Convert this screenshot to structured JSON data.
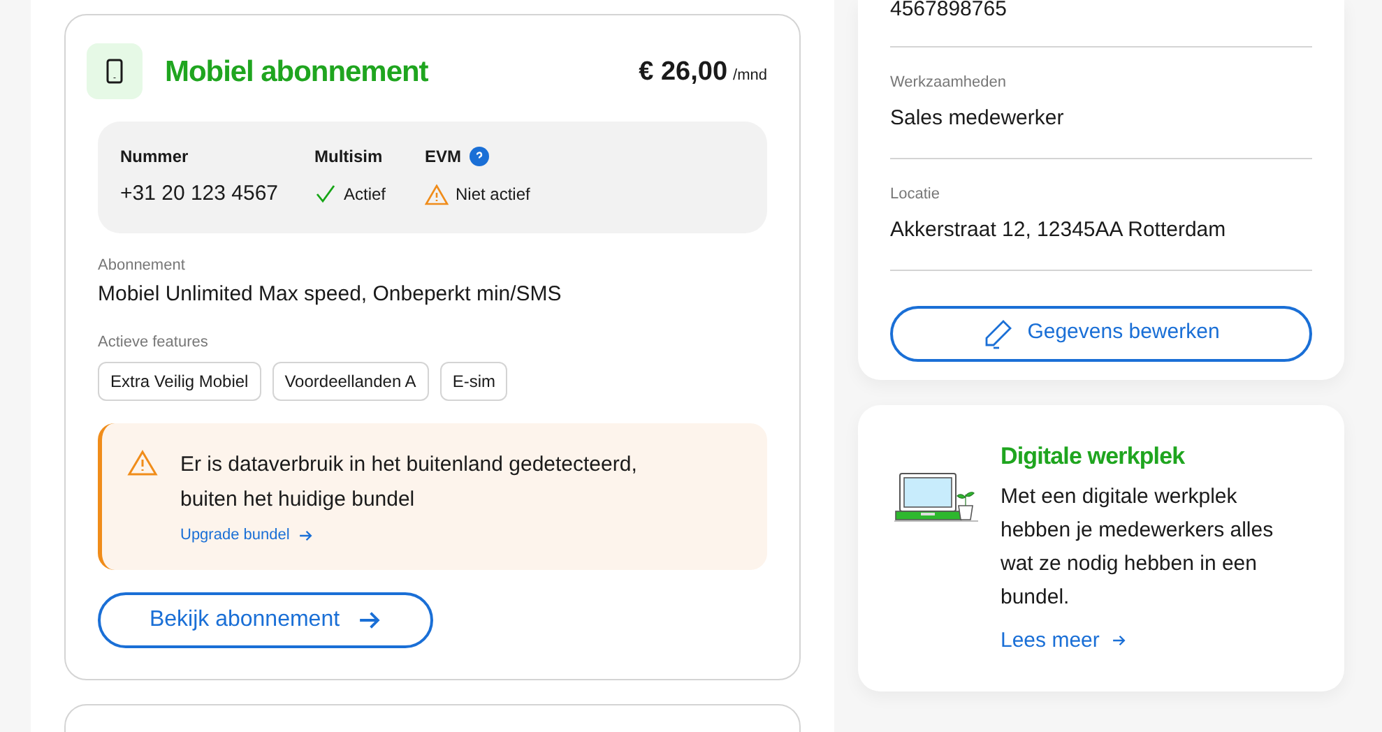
{
  "subscription_card": {
    "title": "Mobiel abonnement",
    "price": "€ 26,00",
    "price_unit": "/mnd",
    "summary": [
      {
        "label": "Nummer",
        "value": "+31 20 123 4567",
        "kind": "text",
        "help": false
      },
      {
        "label": "Multisim",
        "value": "Actief",
        "kind": "active",
        "help": false
      },
      {
        "label": "EVM",
        "value": "Niet actief",
        "kind": "inactive",
        "help": true
      }
    ],
    "plan_label": "Abonnement",
    "plan": "Mobiel Unlimited Max speed, Onbeperkt min/SMS",
    "features_label": "Actieve features",
    "features": [
      "Extra Veilig Mobiel",
      "Voordeellanden A",
      "E-sim"
    ],
    "alert": {
      "message": "Er is dataverbruik in het buitenland gedetecteerd, buiten het huidige bundel",
      "link": "Upgrade bundel"
    },
    "button": "Bekijk abonnement"
  },
  "details_card": {
    "fields": [
      {
        "value": "4567898765"
      },
      {
        "label": "Werkzaamheden",
        "value": "Sales medewerker"
      },
      {
        "label": "Locatie",
        "value": "Akkerstraat 12, 12345AA Rotterdam"
      }
    ],
    "button": "Gegevens bewerken"
  },
  "promo_card": {
    "title": "Digitale werkplek",
    "text": "Met een digitale werkplek hebben je medewerkers alles wat ze nodig hebben in een bundel.",
    "link": "Lees meer"
  }
}
